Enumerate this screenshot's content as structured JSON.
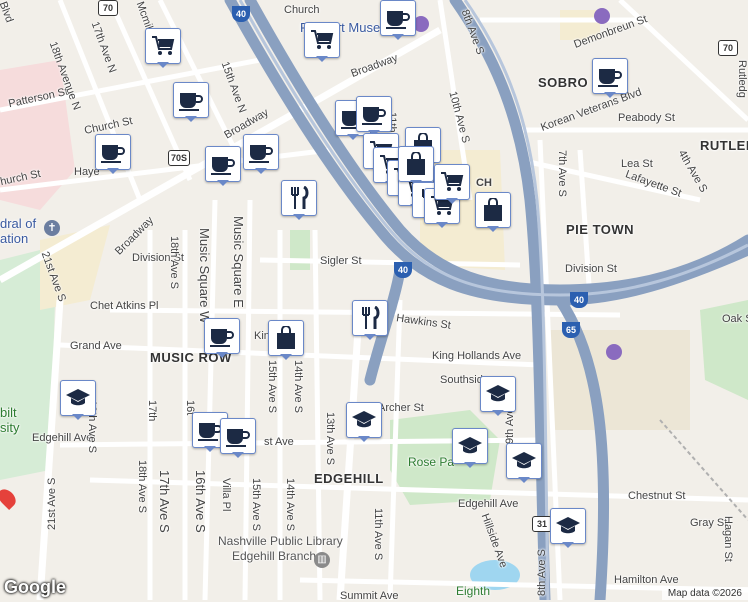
{
  "map": {
    "attribution": "Map data ©2026",
    "logo_text": "Google"
  },
  "neighborhoods": {
    "sobro": "SOBRO",
    "rutledge": "RUTLED",
    "pie_town": "PIE TOWN",
    "music_row": "MUSIC ROW",
    "edgehill": "EDGEHILL"
  },
  "roads": {
    "broadway_1": "Broadway",
    "broadway_2": "Broadway",
    "broadway_3": "Broadway",
    "church_st_1": "Church",
    "church_st_2": "Church St",
    "church_st_3": "hurch St",
    "patterson_st": "Patterson St",
    "demonbreun_st": "Demonbreun St",
    "korean_veterans_blvd": "Korean Veterans Blvd",
    "peabody_st": "Peabody St",
    "lafayette_st": "Lafayette St",
    "lea_st": "Lea St",
    "sigler_st": "Sigler St",
    "division_st_1": "Division St",
    "division_st_2": "Division St",
    "hawkins_st": "Hawkins St",
    "chet_atkins_pl": "Chet Atkins Pl",
    "grand_ave": "Grand Ave",
    "king_hollands_ave_1": "King Hollands Ave",
    "king_hollands_ave_2": "King H",
    "southside": "Southsid",
    "archer_st": "Archer St",
    "edgehill_ave_1": "Edgehill Ave",
    "edgehill_ave_2": "Edgehill Ave",
    "chestnut_st": "Chestnut St",
    "gray_st": "Gray St",
    "hamilton_ave": "Hamilton Ave",
    "summit_ave": "Summit Ave",
    "oak_st": "Oak St",
    "haye": "Haye",
    "ch": "CH",
    "ave_8th_s": "8th Ave S",
    "ave_10th_s": "10th Ave S",
    "ave_7th_s": "7th Ave S",
    "ave_4th_s": "4th Ave S",
    "ave_18th_n": "18th Avenue N",
    "ave_17th_n": "17th Ave N",
    "ave_15th_n": "15th Ave N",
    "ave_18th_s": "18th Ave S",
    "ave_19th_s": "19th Ave S",
    "ave_21st_s_1": "21st Ave S",
    "ave_21st_s_2": "21st Ave S",
    "ave_17th_s": "17th Ave S",
    "ave_16th_s": "16th Ave S",
    "ave_15th_s": "15th Ave S",
    "ave_14th_s": "14th Ave S",
    "ave_13th_s": "13th Ave S",
    "ave_11th_s": "11th Ave S",
    "ave_9th_s": "9th Ave",
    "ave_8th_s_low": "8th Ave S",
    "ave_14th_s_low": "14th Ave S",
    "ave_15th_s_low": "15th Ave S",
    "villa_pl": "Villa Pl",
    "music_square_w": "Music Square W",
    "music_square_e": "Music Square E",
    "hillside_ave": "Hillside Ave",
    "hagan_st": "Hagan St",
    "rutledge_st": "Rutledg",
    "mcmillin": "Mcmillin",
    "blvd": "Blvd",
    "ave_11th": "11th",
    "ave_16th": "16t",
    "ave_17th": "17th",
    "ave_19th": "19th Ave S",
    "st_ave": "st Ave"
  },
  "pois": {
    "frist_museum": "Frist Art Museum",
    "library_line1": "Nashville Public Library",
    "library_line2": "Edgehill Branch",
    "cathedral_line1": "dral of",
    "cathedral_line2": "ation",
    "vanderbilt_line1": "bilt",
    "vanderbilt_line2": "sity",
    "rose_park": "Rose Pa",
    "eighth": "Eighth"
  },
  "shields": {
    "i40_a": "40",
    "i40_b": "40",
    "i40_c": "40",
    "i65": "65",
    "us70": "70",
    "us70s": "70S",
    "us70_b": "70",
    "us31": "31"
  },
  "markers": [
    {
      "type": "shopping-cart",
      "name": "marker-shopping-1"
    },
    {
      "type": "coffee-cup",
      "name": "marker-coffee-1"
    },
    {
      "type": "shopping-cart",
      "name": "marker-shopping-2"
    },
    {
      "type": "coffee-cup",
      "name": "marker-coffee-2"
    },
    {
      "type": "coffee-cup",
      "name": "marker-coffee-3"
    },
    {
      "type": "coffee-cup",
      "name": "marker-coffee-4"
    },
    {
      "type": "coffee-cup",
      "name": "marker-coffee-5"
    },
    {
      "type": "coffee-cup",
      "name": "marker-coffee-6"
    },
    {
      "type": "coffee-cup",
      "name": "marker-coffee-7"
    },
    {
      "type": "coffee-cup",
      "name": "marker-coffee-8"
    },
    {
      "type": "restaurant",
      "name": "marker-restaurant-1"
    },
    {
      "type": "shopping-bag",
      "name": "marker-bag-1"
    },
    {
      "type": "shopping-cart",
      "name": "marker-shopping-3"
    },
    {
      "type": "shopping-cart",
      "name": "marker-shopping-4"
    },
    {
      "type": "shopping-cart",
      "name": "marker-shopping-5"
    },
    {
      "type": "shopping-cart",
      "name": "marker-shopping-6"
    },
    {
      "type": "shopping-bag",
      "name": "marker-bag-2"
    },
    {
      "type": "shopping-bag",
      "name": "marker-bag-3"
    },
    {
      "type": "restaurant",
      "name": "marker-restaurant-2"
    },
    {
      "type": "shopping-cart",
      "name": "marker-shopping-7"
    },
    {
      "type": "shopping-cart",
      "name": "marker-shopping-8"
    },
    {
      "type": "restaurant",
      "name": "marker-restaurant-3"
    },
    {
      "type": "coffee-cup",
      "name": "marker-coffee-9"
    },
    {
      "type": "shopping-bag",
      "name": "marker-bag-4"
    },
    {
      "type": "graduation-cap",
      "name": "marker-school-1"
    },
    {
      "type": "graduation-cap",
      "name": "marker-school-2"
    },
    {
      "type": "graduation-cap",
      "name": "marker-school-3"
    },
    {
      "type": "graduation-cap",
      "name": "marker-school-4"
    },
    {
      "type": "graduation-cap",
      "name": "marker-school-5"
    },
    {
      "type": "graduation-cap",
      "name": "marker-school-6"
    },
    {
      "type": "coffee-cup",
      "name": "marker-coffee-10"
    },
    {
      "type": "coffee-cup",
      "name": "marker-coffee-11"
    }
  ]
}
